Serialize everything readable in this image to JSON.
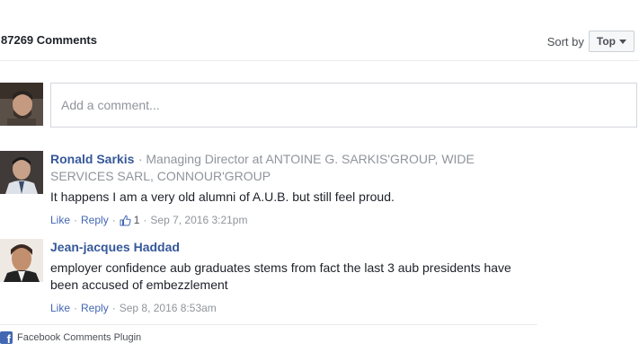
{
  "header": {
    "comment_count": "87269 Comments",
    "sort_label": "Sort by",
    "sort_value": "Top"
  },
  "composer": {
    "placeholder": "Add a comment..."
  },
  "comments": [
    {
      "author": "Ronald Sarkis",
      "subtitle": "· Managing Director at ANTOINE G. SARKIS'GROUP, WIDE SERVICES SARL, CONNOUR'GROUP",
      "text": "It happens I am a very old alumni of A.U.B. but still feel proud.",
      "like": "Like",
      "reply": "Reply",
      "likes": "1",
      "timestamp": "Sep 7, 2016 3:21pm"
    },
    {
      "author": "Jean-jacques Haddad",
      "text": "employer confidence aub graduates stems from fact the last 3 aub presidents have been accused of embezzlement",
      "like": "Like",
      "reply": "Reply",
      "timestamp": "Sep 8, 2016 8:53am"
    }
  ],
  "footer": {
    "label": "Facebook Comments Plugin"
  },
  "colors": {
    "link": "#4267b2",
    "author": "#365899",
    "muted": "#90949c"
  }
}
